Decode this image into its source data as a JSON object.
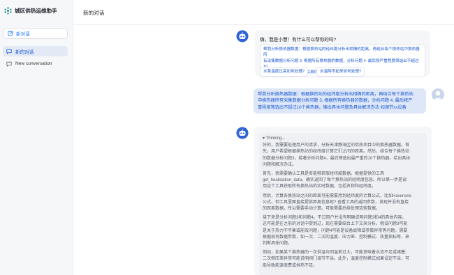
{
  "app": {
    "title": "城区供热运维助手"
  },
  "sidebar": {
    "new_chat_label": "新对话",
    "items": [
      {
        "label": "新的对话",
        "active": true
      },
      {
        "label": "New conversation",
        "active": false
      }
    ]
  },
  "header": {
    "title": "新的对话"
  },
  "chat": {
    "greeting": "嗨，我是小慧！有什么可以帮你的吗?",
    "long_suggestion_lines": [
      "帮我分析换热器数据：根据换热站的经纬度分析出相隔的距离，再结合每个换热站中换热器所",
      "有采集数据分析问题 3. 根据所有换热器的数据，分析问题 4. 最后按严重程度筛选出不超过10",
      "个换热器，输出具体问题及具体解决办法 如调节xx设备"
    ],
    "short_suggestions": [
      "水泵温度过高如何处理?",
      "水温降不起来如何处理?"
    ],
    "user_message_lines": [
      "帮我分析换热器数据：根据换热站的经纬度分析出相隔的距离，再结合每个换热站",
      "中换热器所有采集数据分析问题 3. 根据所有换热器的数据，分析问题 4. 最后按严",
      "重程度筛选出不超过10个换热器，输出具体问题及具体解决办法 如调节xx设备"
    ],
    "thinking_label": "Thinking...",
    "thinking_paragraphs": [
      [
        "好的，我需要处理用户的请求，分析天津静海区的供热项目中的换热器数据。首",
        "先，用户希望根据换热站的经纬度计算它们之间的距离。然后，结合每个换热站",
        "的数据分析问题3，接着分析问题4，最后筛选出最严重的10个换热器，给出具体",
        "问题和解决办法。"
      ],
      [
        "首先，我需要确认工具是否能够获取经纬度数据。根据提供的工具",
        "get_heatstation_data，确实返回了每个换热站的经纬度信息。所以第一步是调",
        "用这个工具获取所有换热站的实时数据，包括名称和经纬度。"
      ],
      [
        "然后，计算各换热站之间的距离可能需要用到经纬度的计算公式，比如Haversine",
        "公式。但工具里面直接提供距离信息呢? 查看工具的返回参数，发现并没有直接",
        "的距离数据，所以需要手动计算。可能需要后续处理这些数据。"
      ],
      [
        "接下来是分析问题3和问题4。不过用户并没有明确说明问题3和4的具体内容。",
        "这可能是在之前的对话中提到过，现在需要结合上下文来分析。假设问题3可能",
        "是关于热力不平衡或能效问题，问题4可能是设备故障或参数异常等问题。需要",
        "根据现有数据参数，如一次、二次的温度、压力差、控制模式、热量指标等，来",
        "判断具体问题。"
      ],
      [
        "例如，如果某个换热器的一次供温与回温差过大，可能意味着水流不足或堵塞;",
        "二次侧压差异常可能说明阀门调节不当。此外，温度控制模式如果设定不当，可",
        "能导致能源浪费或供热不足。"
      ]
    ]
  }
}
